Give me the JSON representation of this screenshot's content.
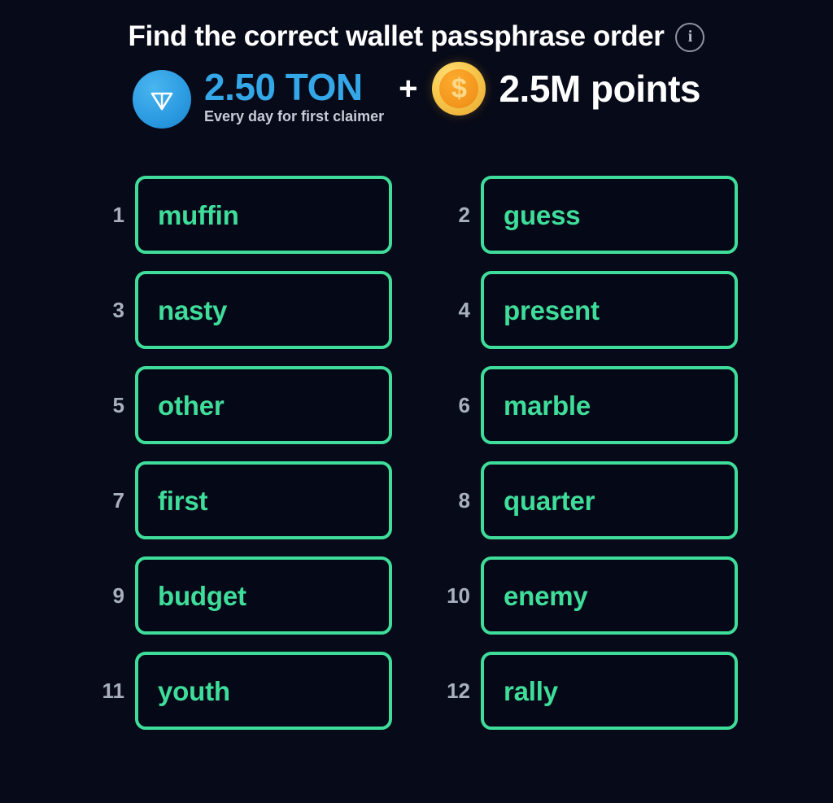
{
  "header": {
    "title": "Find the correct wallet passphrase order",
    "info_icon": "info-icon",
    "info_glyph": "i"
  },
  "reward": {
    "ton_icon": "ton-logo-icon",
    "ton_amount": "2.50 TON",
    "ton_subtitle": "Every day for first claimer",
    "separator": "+",
    "coin_icon": "coin-icon",
    "coin_glyph": "$",
    "points_amount": "2.5M points"
  },
  "colors": {
    "background": "#070a18",
    "tile_border": "#3fdd9a",
    "tile_text": "#3fdd9a",
    "tile_fill": "#050817",
    "index_text": "#a8b0c0",
    "ton_blue": "#33a7e8",
    "title_white": "#ffffff",
    "coin_gold": "#f7c64a"
  },
  "words": [
    {
      "index": "1",
      "word": "muffin"
    },
    {
      "index": "2",
      "word": "guess"
    },
    {
      "index": "3",
      "word": "nasty"
    },
    {
      "index": "4",
      "word": "present"
    },
    {
      "index": "5",
      "word": "other"
    },
    {
      "index": "6",
      "word": "marble"
    },
    {
      "index": "7",
      "word": "first"
    },
    {
      "index": "8",
      "word": "quarter"
    },
    {
      "index": "9",
      "word": "budget"
    },
    {
      "index": "10",
      "word": "enemy"
    },
    {
      "index": "11",
      "word": "youth"
    },
    {
      "index": "12",
      "word": "rally"
    }
  ]
}
